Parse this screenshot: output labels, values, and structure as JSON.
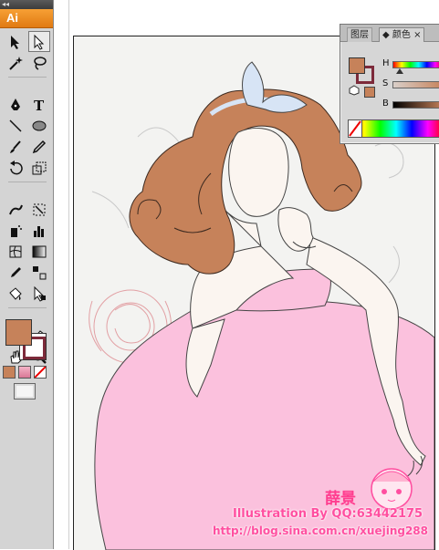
{
  "app": {
    "logo": "Ai",
    "grip": "◂◂"
  },
  "colors": {
    "fill": "#c6825a",
    "stroke": "#7d2a3a",
    "skirt": "#fbc1dd",
    "hair": "#c6825a",
    "bow": "#d7e4f5"
  },
  "tools": [
    {
      "name": "selection-tool-icon",
      "selected": false
    },
    {
      "name": "direct-selection-tool-icon",
      "selected": true
    },
    {
      "name": "magic-wand-tool-icon",
      "selected": false
    },
    {
      "name": "lasso-tool-icon",
      "selected": false
    },
    {
      "name": "pen-tool-icon",
      "selected": false
    },
    {
      "name": "type-tool-icon",
      "selected": false
    },
    {
      "name": "line-segment-tool-icon",
      "selected": false
    },
    {
      "name": "ellipse-tool-icon",
      "selected": false
    },
    {
      "name": "paintbrush-tool-icon",
      "selected": false
    },
    {
      "name": "pencil-tool-icon",
      "selected": false
    },
    {
      "name": "rotate-tool-icon",
      "selected": false
    },
    {
      "name": "scale-tool-icon",
      "selected": false
    },
    {
      "name": "warp-tool-icon",
      "selected": false
    },
    {
      "name": "free-transform-tool-icon",
      "selected": false
    },
    {
      "name": "symbol-sprayer-tool-icon",
      "selected": false
    },
    {
      "name": "column-graph-tool-icon",
      "selected": false
    },
    {
      "name": "mesh-tool-icon",
      "selected": false
    },
    {
      "name": "gradient-tool-icon",
      "selected": false
    },
    {
      "name": "eyedropper-tool-icon",
      "selected": false
    },
    {
      "name": "blend-tool-icon",
      "selected": false
    },
    {
      "name": "live-paint-bucket-tool-icon",
      "selected": false
    },
    {
      "name": "live-paint-selection-tool-icon",
      "selected": false
    },
    {
      "name": "slice-tool-icon",
      "selected": false
    },
    {
      "name": "eraser-tool-icon",
      "selected": false
    },
    {
      "name": "hand-tool-icon",
      "selected": false
    },
    {
      "name": "zoom-tool-icon",
      "selected": false
    }
  ],
  "color_panel": {
    "tabs": [
      "图层",
      "颜色"
    ],
    "active_tab": "颜色",
    "tab_close": "×",
    "sliders": [
      {
        "label": "H"
      },
      {
        "label": "S"
      },
      {
        "label": "B"
      }
    ]
  },
  "credits": {
    "signature_cn": "薛景",
    "line1": "Illustration By QQ:63442175",
    "line2": "http://blog.sina.com.cn/xuejing288"
  }
}
